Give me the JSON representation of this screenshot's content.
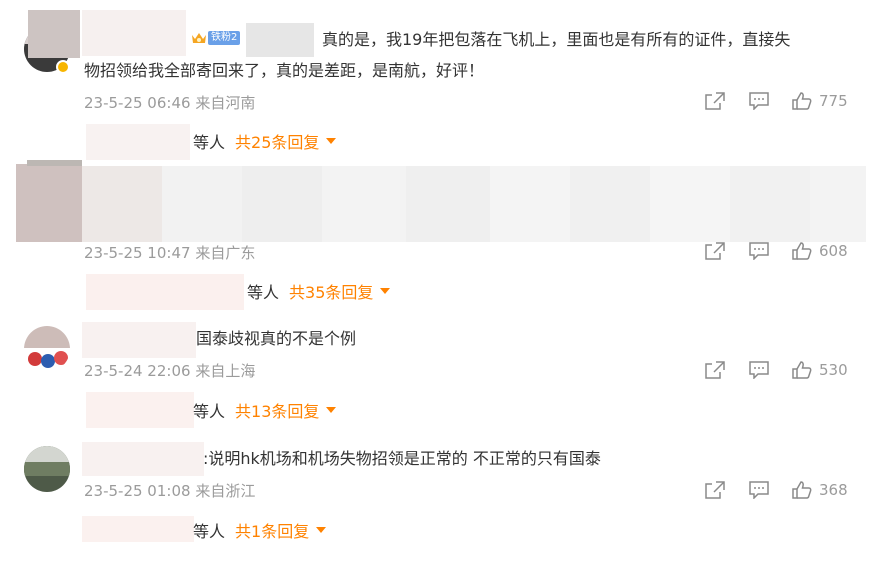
{
  "comments": [
    {
      "text_line1": "真的是，我19年把包落在飞机上，里面也是有所有的证件，直接失",
      "text_line2": "物招领给我全部寄回来了，真的是差距，是南航，好评！",
      "badge": "铁粉2",
      "time": "23-5-25 06:46",
      "location": "来自河南",
      "likes": "775",
      "replies_who": "等人",
      "replies_count": "共25条回复"
    },
    {
      "time": "23-5-25 10:47",
      "location": "来自广东",
      "likes": "608",
      "replies_who": "等人",
      "replies_count": "共35条回复"
    },
    {
      "text_line1": "国泰歧视真的不是个例",
      "time": "23-5-24 22:06",
      "location": "来自上海",
      "likes": "530",
      "replies_who": "等人",
      "replies_count": "共13条回复"
    },
    {
      "text_line1": ":说明hk机场和机场失物招领是正常的 不正常的只有国泰",
      "time": "23-5-25 01:08",
      "location": "来自浙江",
      "likes": "368",
      "replies_who": "等人",
      "replies_count": "共1条回复"
    }
  ],
  "icons": {
    "share": "share-icon",
    "comment": "comment-icon",
    "like": "like-icon"
  },
  "colors": {
    "accent": "#ff8200",
    "meta": "#9b9b9b",
    "text": "#333333"
  }
}
